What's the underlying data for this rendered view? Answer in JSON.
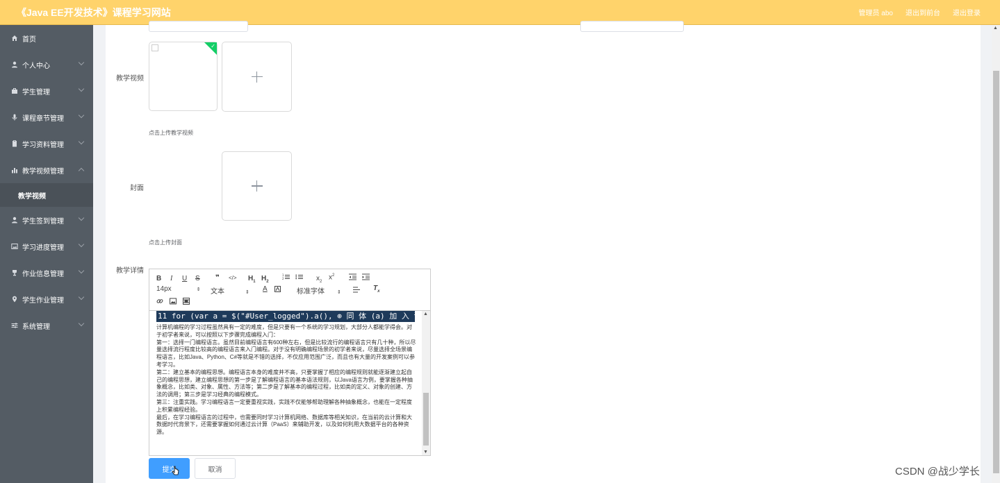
{
  "header": {
    "title": "《Java EE开发技术》课程学习网站",
    "user": "管理员 abo",
    "goto_front": "退出到前台",
    "logout": "退出登录"
  },
  "sidebar": {
    "items": [
      {
        "label": "首页",
        "icon": "home-icon"
      },
      {
        "label": "个人中心",
        "icon": "user-icon"
      },
      {
        "label": "学生管理",
        "icon": "briefcase-icon"
      },
      {
        "label": "课程章节管理",
        "icon": "microphone-icon"
      },
      {
        "label": "学习资料管理",
        "icon": "document-icon"
      },
      {
        "label": "教学视频管理",
        "icon": "bar-chart-icon"
      },
      {
        "label": "学生签到管理",
        "icon": "user-icon"
      },
      {
        "label": "学习进度管理",
        "icon": "picture-icon"
      },
      {
        "label": "作业信息管理",
        "icon": "trophy-icon"
      },
      {
        "label": "学生作业管理",
        "icon": "location-icon"
      },
      {
        "label": "系统管理",
        "icon": "sliders-icon"
      }
    ],
    "active_sub": "教学视频"
  },
  "form": {
    "video_label": "教学视频",
    "video_hint": "点击上传教学视频",
    "cover_label": "封面",
    "cover_hint": "点击上传封面",
    "detail_label": "教学详情"
  },
  "editor": {
    "font_size": "14px",
    "heading_select": "文本",
    "font_family": "标准字体",
    "code_line": "11     for (var a = $(\"#User_logged\").a(), ⊕ 同 体 (a) 加 入 课",
    "content": [
      "计算机编程的学习过程虽然具有一定的难度，但是只要有一个系统的学习规划，大部分人都能学得会。对于初学者来说，可以按照以下步骤完成编程入门：",
      "第一：选择一门编程语言。虽然目前编程语言有600种左右，但是比较流行的编程语言只有几十种，所以尽量选择流行程度比较高的编程语言来入门编程。对于没有明确编程场景的初学者来说，尽量选择全场景编程语言，比如Java、Python、C#等就是不错的选择，不仅应用范围广泛，而且也有大量的开发案例可以参考学习。",
      "第二：建立基本的编程思想。编程语言本身的难度并不高，只要掌握了相应的编程规则就能逐渐建立起自己的编程思想，建立编程思想的第一步是了解编程语言的基本语法规则，以Java语言为例，要掌握各种抽象概念，比如类、对象、属性、方法等；第二步是了解基本的编程过程，比如类的定义、对象的创建、方法的调用；第三步是学习经典的编程模式。",
      "第三：注重实践。学习编程语言一定要重视实践，实践不仅能够帮助理解各种抽象概念，也能在一定程度上积累编程经验。",
      "最后，在学习编程语言的过程中，也需要同时学习计算机网络、数据库等相关知识，在当前的云计算和大数据时代背景下，还需要掌握如何通过云计算（PaaS）来辅助开发，以及如何利用大数据平台的各种资源。"
    ]
  },
  "buttons": {
    "submit": "提交",
    "cancel": "取消"
  },
  "watermark": "CSDN @战少学长",
  "colors": {
    "header": "#ffd36b",
    "sidebar": "#545c64",
    "primary": "#409eff",
    "success": "#13ce66"
  }
}
